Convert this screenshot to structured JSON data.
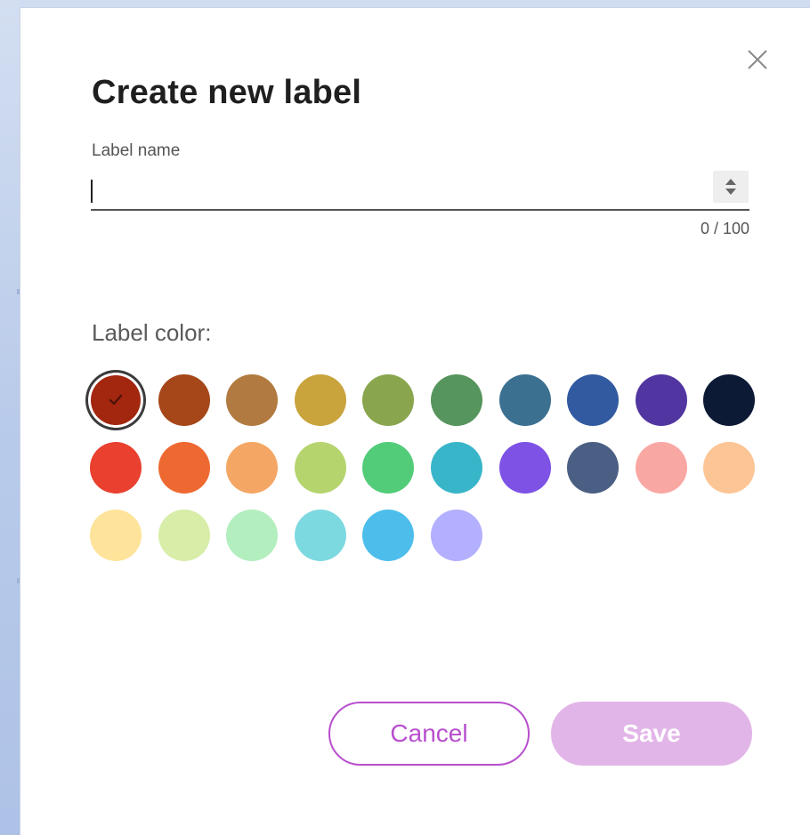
{
  "dialog": {
    "title": "Create new label",
    "label_name_field": {
      "label": "Label name",
      "value": "",
      "counter": "0 / 100"
    },
    "color_section": {
      "label": "Label color:",
      "selected_index": 0,
      "colors": [
        "#a3260f",
        "#a64719",
        "#b17a40",
        "#c9a33c",
        "#89a64f",
        "#56955d",
        "#3b7090",
        "#325aa0",
        "#5136a1",
        "#0d1a36",
        "#e9402f",
        "#ee6932",
        "#f4a764",
        "#b6d46e",
        "#53cc7a",
        "#38b5c8",
        "#7d52e5",
        "#4a5f83",
        "#f9a7a3",
        "#fcc596",
        "#fee39a",
        "#d7eda8",
        "#b3efbe",
        "#7dd9e0",
        "#4dbeec",
        "#b3b0ff"
      ]
    },
    "buttons": {
      "cancel_label": "Cancel",
      "save_label": "Save"
    },
    "icons": {
      "close": "close-icon",
      "check": "check-icon",
      "spinner": "sort-arrows-icon"
    }
  }
}
